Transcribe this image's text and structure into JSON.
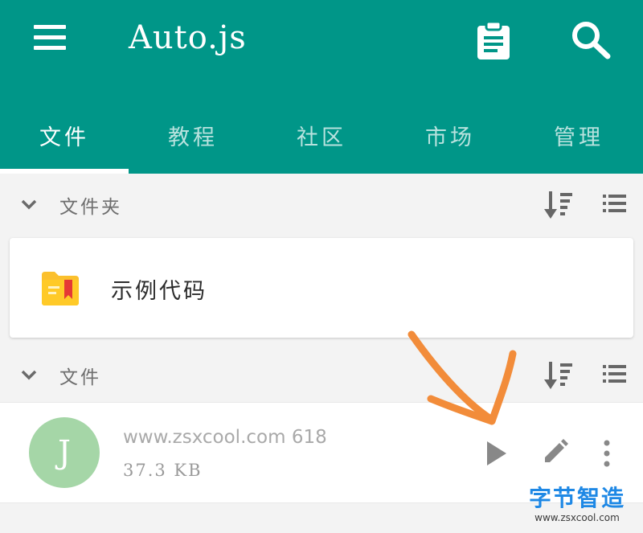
{
  "appbar": {
    "title": "Auto.js",
    "menu_icon": "hamburger-menu-icon",
    "actions": [
      "clipboard-icon",
      "search-icon"
    ],
    "background_color": "#009688"
  },
  "tabs": [
    {
      "label": "文件",
      "active": true
    },
    {
      "label": "教程",
      "active": false
    },
    {
      "label": "社区",
      "active": false
    },
    {
      "label": "市场",
      "active": false
    },
    {
      "label": "管理",
      "active": false
    }
  ],
  "folders_section": {
    "label": "文件夹",
    "icons": [
      "chevron-down-icon",
      "sort-icon",
      "list-view-icon"
    ],
    "items": [
      {
        "name": "示例代码",
        "icon": "folder-icon"
      }
    ]
  },
  "files_section": {
    "label": "文件",
    "icons": [
      "chevron-down-icon",
      "sort-icon",
      "list-view-icon"
    ],
    "items": [
      {
        "avatar_letter": "J",
        "avatar_color": "#a5d6a7",
        "name": "www.zsxcool.com 618",
        "size": "37.3 KB",
        "actions": [
          "play-icon",
          "edit-icon",
          "more-vert-icon"
        ]
      }
    ]
  },
  "watermark": {
    "title": "字节智造",
    "url": "www.zsxcool.com"
  },
  "annotation_color": "#f28c3a"
}
